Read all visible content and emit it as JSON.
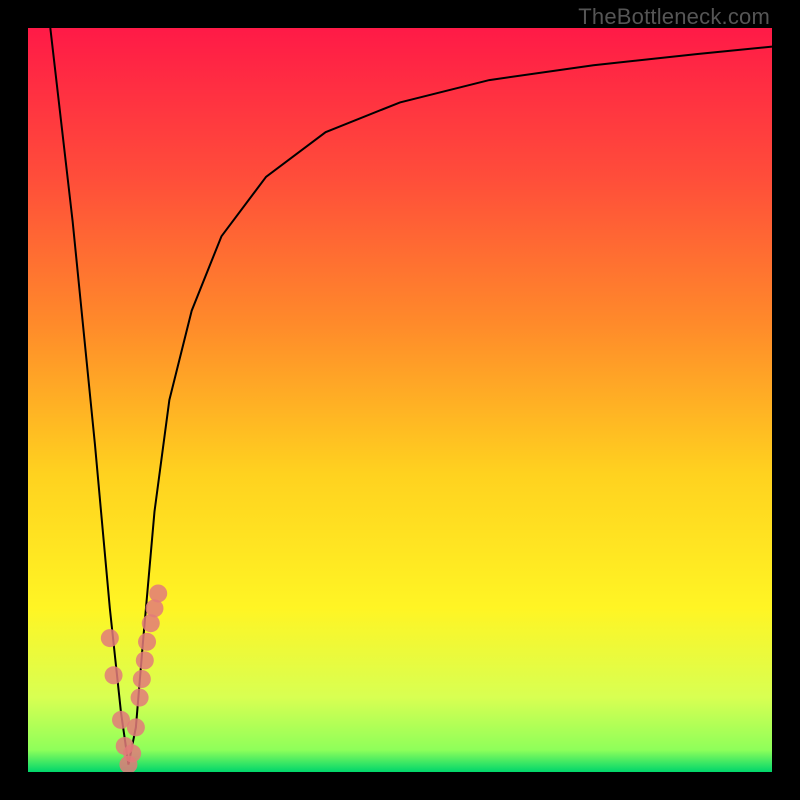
{
  "watermark": "TheBottleneck.com",
  "chart_data": {
    "type": "line",
    "title": "",
    "xlabel": "",
    "ylabel": "",
    "xlim": [
      0,
      100
    ],
    "ylim": [
      0,
      100
    ],
    "grid": false,
    "legend": false,
    "background": {
      "description": "Vertical gradient from red (top) through orange/yellow to green (bottom), indicating bottleneck severity.",
      "stops": [
        {
          "y": 0,
          "color": "#ff1a47"
        },
        {
          "y": 20,
          "color": "#ff4d3a"
        },
        {
          "y": 40,
          "color": "#ff8b2a"
        },
        {
          "y": 60,
          "color": "#ffd21f"
        },
        {
          "y": 78,
          "color": "#fff524"
        },
        {
          "y": 90,
          "color": "#d8ff52"
        },
        {
          "y": 97,
          "color": "#8fff5a"
        },
        {
          "y": 100,
          "color": "#00d66b"
        }
      ]
    },
    "series": [
      {
        "name": "bottleneck-curve",
        "type": "line",
        "color": "#000000",
        "x": [
          3,
          6,
          9,
          11,
          12.5,
          13.5,
          14.5,
          15.5,
          17,
          19,
          22,
          26,
          32,
          40,
          50,
          62,
          76,
          90,
          100
        ],
        "y": [
          100,
          74,
          44,
          22,
          8,
          1,
          6,
          18,
          35,
          50,
          62,
          72,
          80,
          86,
          90,
          93,
          95,
          96.5,
          97.5
        ]
      },
      {
        "name": "highlight-markers",
        "type": "scatter",
        "color": "#e27a7a",
        "marker_size": 9,
        "x": [
          11.0,
          11.5,
          12.5,
          13.0,
          13.5,
          14.0,
          14.5,
          15.0,
          15.3,
          15.7,
          16.0,
          16.5,
          17.0,
          17.5
        ],
        "y": [
          18.0,
          13.0,
          7.0,
          3.5,
          1.0,
          2.5,
          6.0,
          10.0,
          12.5,
          15.0,
          17.5,
          20.0,
          22.0,
          24.0
        ]
      }
    ],
    "minimum": {
      "x": 13.5,
      "y": 1.0
    }
  }
}
